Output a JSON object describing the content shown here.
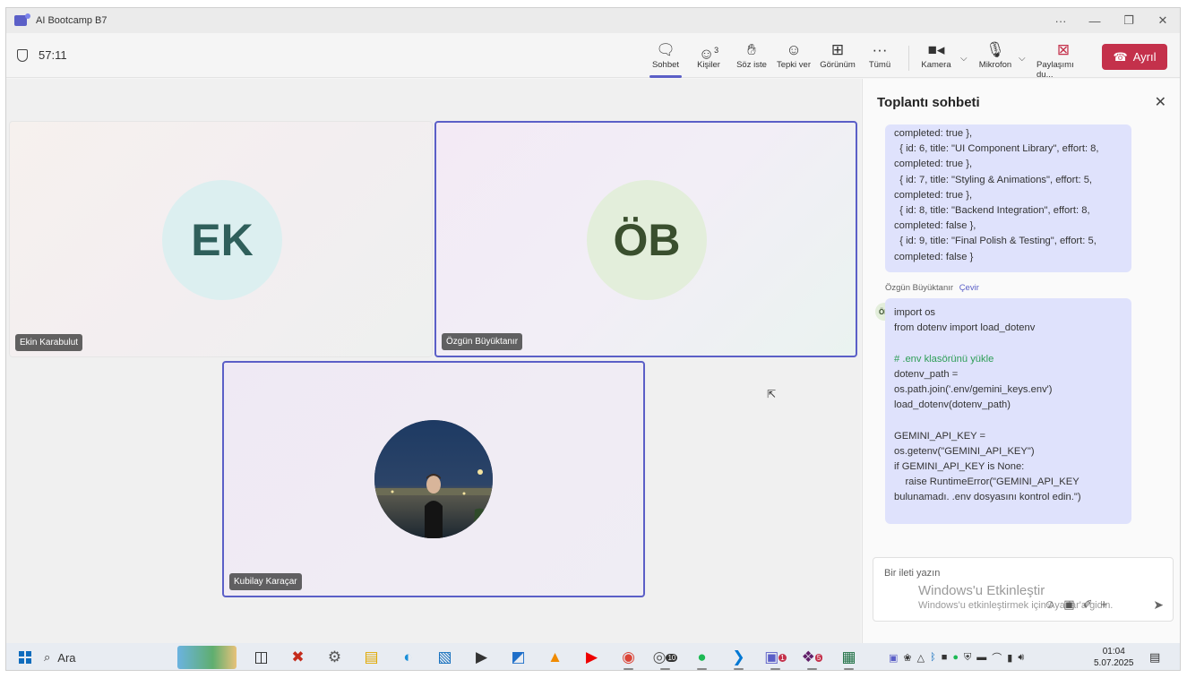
{
  "window": {
    "title": "AI Bootcamp B7",
    "controls": [
      "···",
      "—",
      "❐",
      "✕"
    ]
  },
  "toolbar": {
    "timer": "57:11",
    "chat_label": "Sohbet",
    "people_label": "Kişiler",
    "people_count": "3",
    "raise_hand_label": "Söz iste",
    "react_label": "Tepki ver",
    "view_label": "Görünüm",
    "more_label": "Tümü",
    "camera_label": "Kamera",
    "mic_label": "Mikrofon",
    "share_label": "Paylaşımı du...",
    "leave_label": "Ayrıl"
  },
  "participants": [
    {
      "name": "Ekin Karabulut",
      "initials": "EK",
      "avatar_color": "#dceff0",
      "initials_color": "#2f5f5b"
    },
    {
      "name": "Özgün Büyüktanır",
      "initials": "ÖB",
      "avatar_color": "#e3eedb",
      "initials_color": "#3a4f2e"
    },
    {
      "name": "Kubilay Karaçar",
      "initials": ""
    }
  ],
  "chat": {
    "header": "Toplantı sohbeti",
    "message_1": "completed: true },\n  { id: 6, title: \"UI Component Library\", effort: 8, completed: true },\n  { id: 7, title: \"Styling & Animations\", effort: 5, completed: true },\n  { id: 8, title: \"Backend Integration\", effort: 8, completed: false },\n  { id: 9, title: \"Final Polish & Testing\", effort: 5, completed: false }",
    "sender": "Özgün Büyüktanır",
    "translate": "Çevir",
    "sender_initials": "ÖB",
    "code_part_1": "import os\nfrom dotenv import load_dotenv\n\n",
    "code_comment": "# .env klasörünü yükle",
    "code_part_2": "\ndotenv_path =\nos.path.join('.env/gemini_keys.env')\nload_dotenv(dotenv_path)\n\nGEMINI_API_KEY =\nos.getenv(\"GEMINI_API_KEY\")\nif GEMINI_API_KEY is None:\n    raise RuntimeError(\"GEMINI_API_KEY bulunamadı. .env dosyasını kontrol edin.\")",
    "compose_placeholder": "Bir ileti yazın",
    "watermark_title": "Windows'u Etkinleştir",
    "watermark_sub": "Windows'u etkinleştirmek için Ayarlar'a gidin."
  },
  "taskbar": {
    "search_label": "Ara",
    "time": "01:04",
    "date": "5.07.2025",
    "chrome_badge": "10",
    "teams_badge": "1",
    "slack_badge": "5"
  },
  "colors": {
    "accent": "#5b5fc7",
    "leave": "#c4314b",
    "chat_bubble": "#dfe2fc",
    "code_comment": "#2e9e57"
  }
}
